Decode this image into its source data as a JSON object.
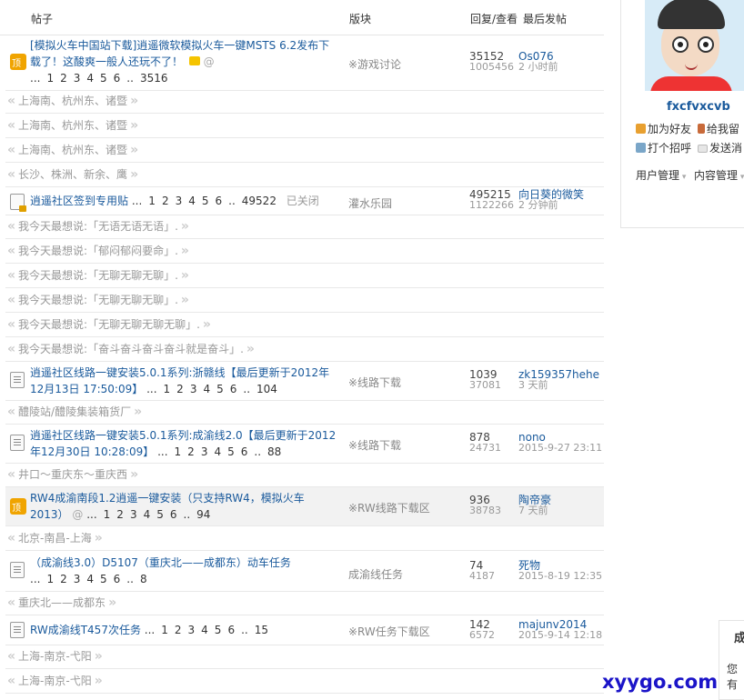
{
  "header": {
    "col_topic": "帖子",
    "col_forum": "版块",
    "col_stats": "回复/查看",
    "col_last": "最后发帖"
  },
  "threads": [
    {
      "title": "[模拟火车中国站下载]逍遥微软模拟火车一键MSTS 6.2发布下载了！这酸爽一般人还玩不了！",
      "pages": [
        "...",
        "1",
        "2",
        "3",
        "4",
        "5",
        "6",
        "..",
        "3516"
      ],
      "forum": "※游戏讨论",
      "replies": "35152",
      "views": "1005456",
      "last_user": "Os076",
      "last_time": "2 小时前",
      "icon": "pinned-icon",
      "quotes": [
        "上海南、杭州东、诸暨",
        "上海南、杭州东、诸暨",
        "上海南、杭州东、诸暨",
        "长沙、株洲、新余、鹰"
      ]
    },
    {
      "title": "逍遥社区签到专用贴",
      "pages": [
        "...",
        "1",
        "2",
        "3",
        "4",
        "5",
        "6",
        "..",
        "49522"
      ],
      "status": "已关闭",
      "forum": "灌水乐园",
      "replies": "495215",
      "views": "1122266",
      "last_user": "向日葵的微笑",
      "last_time": "2 分钟前",
      "icon": "locked-icon",
      "quotes": [
        "我今天最想说:「无语无语无语」.",
        "我今天最想说:「郁闷郁闷要命」.",
        "我今天最想说:「无聊无聊无聊」.",
        "我今天最想说:「无聊无聊无聊」.",
        "我今天最想说:「无聊无聊无聊无聊」.",
        "我今天最想说:「奋斗奋斗奋斗奋斗就是奋斗」."
      ]
    },
    {
      "title": "逍遥社区线路一键安装5.0.1系列:浙赣线【最后更新于2012年12月13日 17:50:09】",
      "pages": [
        "...",
        "1",
        "2",
        "3",
        "4",
        "5",
        "6",
        "..",
        "104"
      ],
      "forum": "※线路下载",
      "replies": "1039",
      "views": "37081",
      "last_user": "zk159357hehe",
      "last_time": "3 天前",
      "icon": "document-icon",
      "quotes": [
        "醴陵站/醴陵集装箱货厂"
      ]
    },
    {
      "title": "逍遥社区线路一键安装5.0.1系列:成渝线2.0【最后更新于2012年12月30日 10:28:09】",
      "pages": [
        "...",
        "1",
        "2",
        "3",
        "4",
        "5",
        "6",
        "..",
        "88"
      ],
      "forum": "※线路下载",
      "replies": "878",
      "views": "24731",
      "last_user": "nono",
      "last_time": "2015-9-27 23:11",
      "icon": "document-icon",
      "quotes": [
        "井口～重庆东～重庆西"
      ]
    },
    {
      "title": "RW4成渝南段1.2逍遥一键安装（只支持RW4，模拟火车2013）",
      "pages": [
        "...",
        "1",
        "2",
        "3",
        "4",
        "5",
        "6",
        "..",
        "94"
      ],
      "forum": "※RW线路下载区",
      "replies": "936",
      "views": "38783",
      "last_user": "陶帝豪",
      "last_time": "7 天前",
      "icon": "pinned-icon",
      "quotes": [
        "北京-南昌-上海"
      ]
    },
    {
      "title": "（成渝线3.0）D5107（重庆北——成都东）动车任务",
      "pages": [
        "...",
        "1",
        "2",
        "3",
        "4",
        "5",
        "6",
        "..",
        "8"
      ],
      "forum": "成渝线任务",
      "replies": "74",
      "views": "4187",
      "last_user": "死物",
      "last_time": "2015-8-19 12:35",
      "icon": "document-icon",
      "quotes": [
        "重庆北——成都东"
      ]
    },
    {
      "title": "RW成渝线T457次任务",
      "pages": [
        "...",
        "1",
        "2",
        "3",
        "4",
        "5",
        "6",
        "..",
        "15"
      ],
      "forum": "※RW任务下载区",
      "replies": "142",
      "views": "6572",
      "last_user": "majunv2014",
      "last_time": "2015-9-14 12:18",
      "icon": "document-icon",
      "quotes": [
        "上海-南京-弋阳",
        "上海-南京-弋阳"
      ]
    }
  ],
  "sidebar": {
    "username": "fxcfvxcvb",
    "add_friend": "加为好友",
    "leave_msg": "给我留",
    "greet": "打个招呼",
    "send_msg": "发送消",
    "user_mgmt": "用户管理",
    "content_mgmt": "内容管理"
  },
  "side_panel": {
    "heading": "成",
    "text": "您有"
  },
  "watermark": "xyygo.com"
}
